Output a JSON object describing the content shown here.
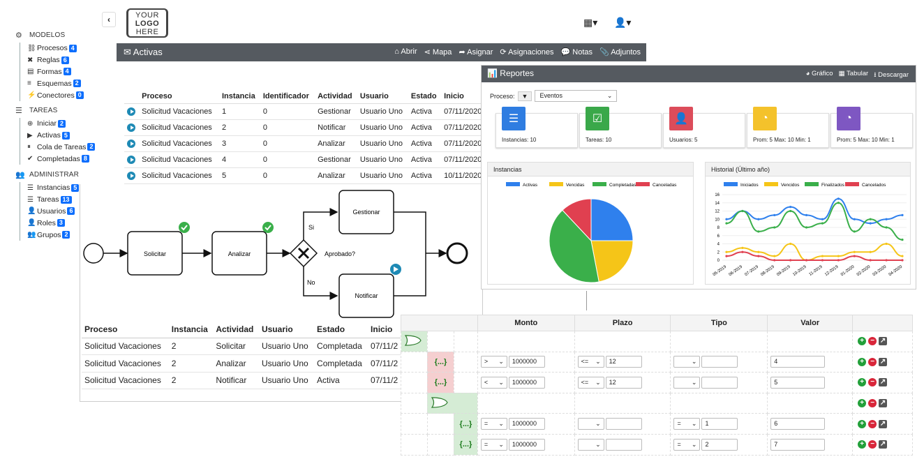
{
  "logo": {
    "lines": [
      "YOUR",
      "LOGO",
      "HERE"
    ]
  },
  "sidebar": {
    "sections": [
      {
        "label": "MODELOS",
        "icon": "users-cog-icon",
        "items": [
          {
            "label": "Procesos",
            "count": "4",
            "icon": "process-icon"
          },
          {
            "label": "Reglas",
            "count": "6",
            "icon": "tools-icon"
          },
          {
            "label": "Formas",
            "count": "4",
            "icon": "form-icon"
          },
          {
            "label": "Esquemas",
            "count": "2",
            "icon": "database-icon"
          },
          {
            "label": "Conectores",
            "count": "0",
            "icon": "plug-icon"
          }
        ]
      },
      {
        "label": "TAREAS",
        "icon": "tasks-icon",
        "items": [
          {
            "label": "Iniciar",
            "count": "2",
            "icon": "plus-circle-icon"
          },
          {
            "label": "Activas",
            "count": "5",
            "icon": "play-circle-icon"
          },
          {
            "label": "Cola de Tareas",
            "count": "2",
            "icon": "pause-circle-icon"
          },
          {
            "label": "Completadas",
            "count": "8",
            "icon": "check-circle-icon"
          }
        ]
      },
      {
        "label": "ADMINISTRAR",
        "icon": "user-cog-icon",
        "items": [
          {
            "label": "Instancias",
            "count": "5",
            "icon": "list-icon"
          },
          {
            "label": "Tareas",
            "count": "13",
            "icon": "tasks-icon"
          },
          {
            "label": "Usuarios",
            "count": "6",
            "icon": "user-icon"
          },
          {
            "label": "Roles",
            "count": "3",
            "icon": "user-tag-icon"
          },
          {
            "label": "Grupos",
            "count": "2",
            "icon": "users-icon"
          }
        ]
      }
    ]
  },
  "activas": {
    "title": "Activas",
    "actions": [
      "Abrir",
      "Mapa",
      "Asignar",
      "Asignaciones",
      "Notas",
      "Adjuntos"
    ],
    "columns": [
      "Proceso",
      "Instancia",
      "Identificador",
      "Actividad",
      "Usuario",
      "Estado",
      "Inicio"
    ],
    "rows": [
      [
        "Solicitud Vacaciones",
        "1",
        "0",
        "Gestionar",
        "Usuario Uno",
        "Activa",
        "07/11/2020"
      ],
      [
        "Solicitud Vacaciones",
        "2",
        "0",
        "Notificar",
        "Usuario Uno",
        "Activa",
        "07/11/2020"
      ],
      [
        "Solicitud Vacaciones",
        "3",
        "0",
        "Analizar",
        "Usuario Uno",
        "Activa",
        "07/11/2020"
      ],
      [
        "Solicitud Vacaciones",
        "4",
        "0",
        "Gestionar",
        "Usuario Uno",
        "Activa",
        "07/11/2020"
      ],
      [
        "Solicitud Vacaciones",
        "5",
        "0",
        "Analizar",
        "Usuario Uno",
        "Activa",
        "10/11/2020"
      ]
    ]
  },
  "bpmn": {
    "tasks": [
      "Solicitar",
      "Analizar",
      "Gestionar",
      "Notificar"
    ],
    "gateway": "Aprobado?",
    "yes": "Si",
    "no": "No",
    "columns": [
      "Proceso",
      "Instancia",
      "Actividad",
      "Usuario",
      "Estado",
      "Inicio"
    ],
    "rows": [
      [
        "Solicitud Vacaciones",
        "2",
        "Solicitar",
        "Usuario Uno",
        "Completada",
        "07/11/2"
      ],
      [
        "Solicitud Vacaciones",
        "2",
        "Analizar",
        "Usuario Uno",
        "Completada",
        "07/11/2"
      ],
      [
        "Solicitud Vacaciones",
        "2",
        "Notificar",
        "Usuario Uno",
        "Activa",
        "07/11/2"
      ]
    ]
  },
  "reportes": {
    "title": "Reportes",
    "actions": [
      "Gráfico",
      "Tabular",
      "Descargar"
    ],
    "proceso_label": "Proceso:",
    "proceso_value": "Eventos",
    "cards": [
      {
        "label": "Instancias: 10",
        "color": "#2f7de1",
        "icon": "list-icon"
      },
      {
        "label": "Tareas: 10",
        "color": "#3aa84a",
        "icon": "checklist-icon"
      },
      {
        "label": "Usuarios: 5",
        "color": "#dc4c5a",
        "icon": "user-icon"
      },
      {
        "label": "Prom: 5 Max: 10 Min: 1",
        "color": "#f4c22b",
        "icon": "clock-icon"
      },
      {
        "label": "Prom: 5 Max: 10 Min: 1",
        "color": "#7e57c2",
        "icon": "clock-icon"
      }
    ],
    "pie_title": "Instancias",
    "hist_title": "Historial (Último año)"
  },
  "chart_data": [
    {
      "type": "pie",
      "title": "Instancias",
      "legend": [
        "Activas",
        "Vencidas",
        "Completadas",
        "Canceladas"
      ],
      "values": [
        25,
        22,
        41,
        12
      ],
      "colors": [
        "#2f80ed",
        "#f5c518",
        "#3aaf4a",
        "#e04050"
      ]
    },
    {
      "type": "line",
      "title": "Historial (Último año)",
      "categories": [
        "05-2019",
        "06-2019",
        "07-2019",
        "08-2019",
        "09-2019",
        "10-2019",
        "11-2019",
        "12-2019",
        "01-2020",
        "02-2020",
        "03-2020",
        "04-2020"
      ],
      "ylim": [
        0,
        16
      ],
      "yticks": [
        0,
        2,
        4,
        6,
        8,
        10,
        12,
        14,
        16
      ],
      "series": [
        {
          "name": "Iniciados",
          "color": "#2f80ed",
          "values": [
            10,
            12,
            10,
            11,
            13,
            11,
            10,
            15,
            10,
            9,
            10,
            11
          ]
        },
        {
          "name": "Vencidos",
          "color": "#f5c518",
          "values": [
            2,
            3,
            2,
            1,
            4,
            0,
            1,
            1,
            2,
            2,
            4,
            1
          ]
        },
        {
          "name": "Finalizados",
          "color": "#3aaf4a",
          "values": [
            9,
            12,
            7,
            8,
            12,
            8,
            9,
            14,
            7,
            10,
            8,
            5
          ]
        },
        {
          "name": "Cancelados",
          "color": "#e04050",
          "values": [
            1,
            2,
            1,
            0,
            0,
            0,
            0,
            0,
            1,
            0,
            0,
            0
          ]
        }
      ]
    }
  ],
  "rules": {
    "columns": [
      "Monto",
      "Plazo",
      "Tipo",
      "Valor"
    ],
    "rows": [
      {
        "kind": "gate",
        "monto_op": "",
        "monto": "",
        "plazo_op": "",
        "plazo": "",
        "tipo_op": "",
        "tipo": "",
        "valor": ""
      },
      {
        "kind": "rule",
        "monto_op": ">",
        "monto": "1000000",
        "plazo_op": "<=",
        "plazo": "12",
        "tipo_op": "",
        "tipo": "",
        "valor": "4"
      },
      {
        "kind": "rule",
        "monto_op": "<",
        "monto": "1000000",
        "plazo_op": "<=",
        "plazo": "12",
        "tipo_op": "",
        "tipo": "",
        "valor": "5"
      },
      {
        "kind": "gate2",
        "monto_op": "",
        "monto": "",
        "plazo_op": "",
        "plazo": "",
        "tipo_op": "",
        "tipo": "",
        "valor": ""
      },
      {
        "kind": "rule2",
        "monto_op": "=",
        "monto": "1000000",
        "plazo_op": "",
        "plazo": "",
        "tipo_op": "=",
        "tipo": "1",
        "valor": "6"
      },
      {
        "kind": "rule2",
        "monto_op": "=",
        "monto": "1000000",
        "plazo_op": "",
        "plazo": "",
        "tipo_op": "=",
        "tipo": "2",
        "valor": "7"
      }
    ],
    "brace": "{...}"
  }
}
